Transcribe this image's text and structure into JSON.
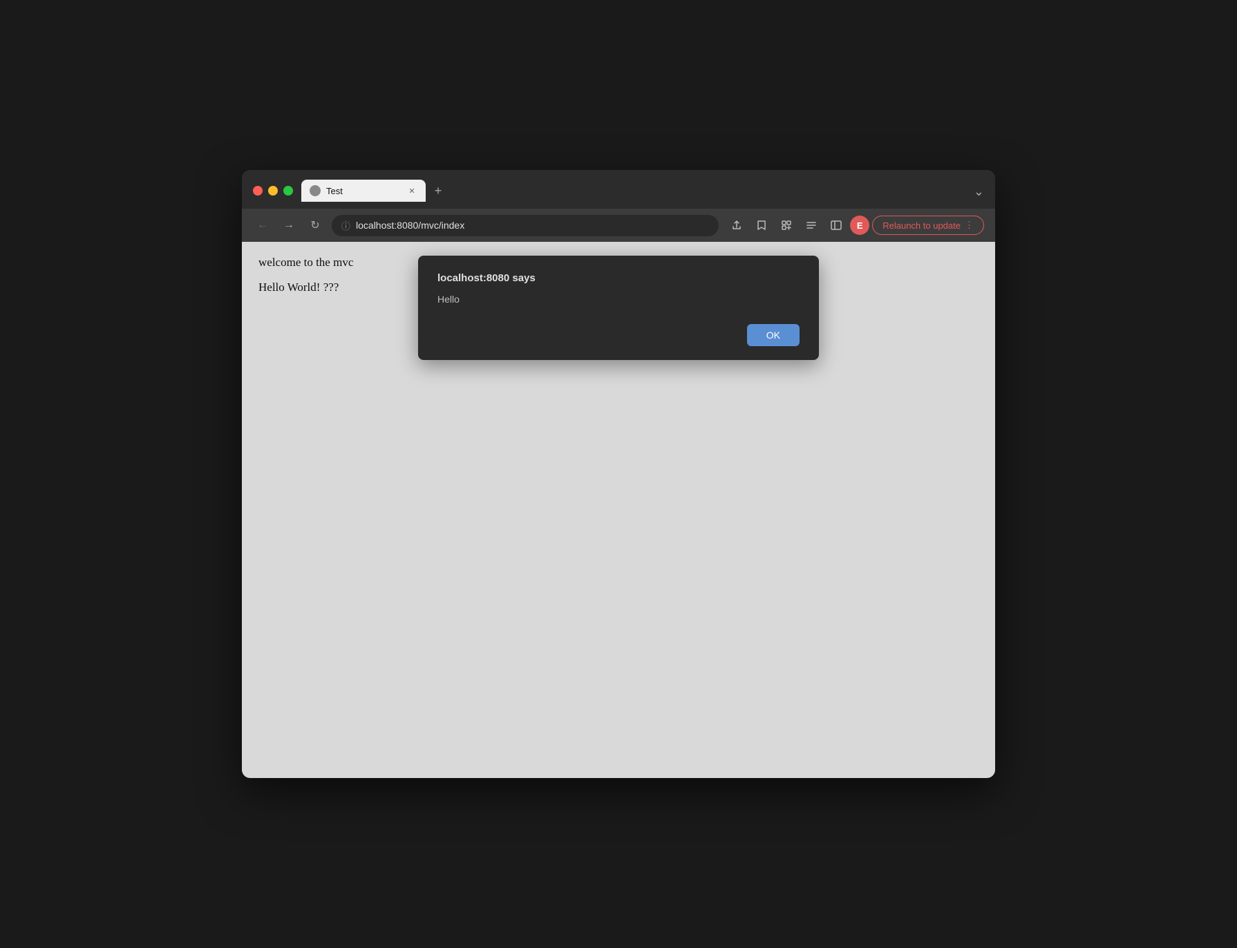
{
  "window": {
    "title": "Test"
  },
  "tab": {
    "title": "Test",
    "favicon": "globe"
  },
  "address_bar": {
    "url": "localhost:8080/mvc/index",
    "icon": "ⓘ"
  },
  "toolbar": {
    "back_label": "←",
    "forward_label": "→",
    "reload_label": "↻",
    "share_icon": "share",
    "bookmark_icon": "★",
    "extensions_icon": "puzzle",
    "reading_list_icon": "list",
    "sidebar_icon": "sidebar",
    "profile_initial": "E",
    "relaunch_label": "Relaunch to update",
    "more_icon": "⋮",
    "new_tab_icon": "+",
    "dropdown_icon": "⌄"
  },
  "page": {
    "line1": "welcome to the mvc",
    "line2": "Hello World! ???"
  },
  "dialog": {
    "title": "localhost:8080 says",
    "message": "Hello",
    "ok_label": "OK"
  }
}
